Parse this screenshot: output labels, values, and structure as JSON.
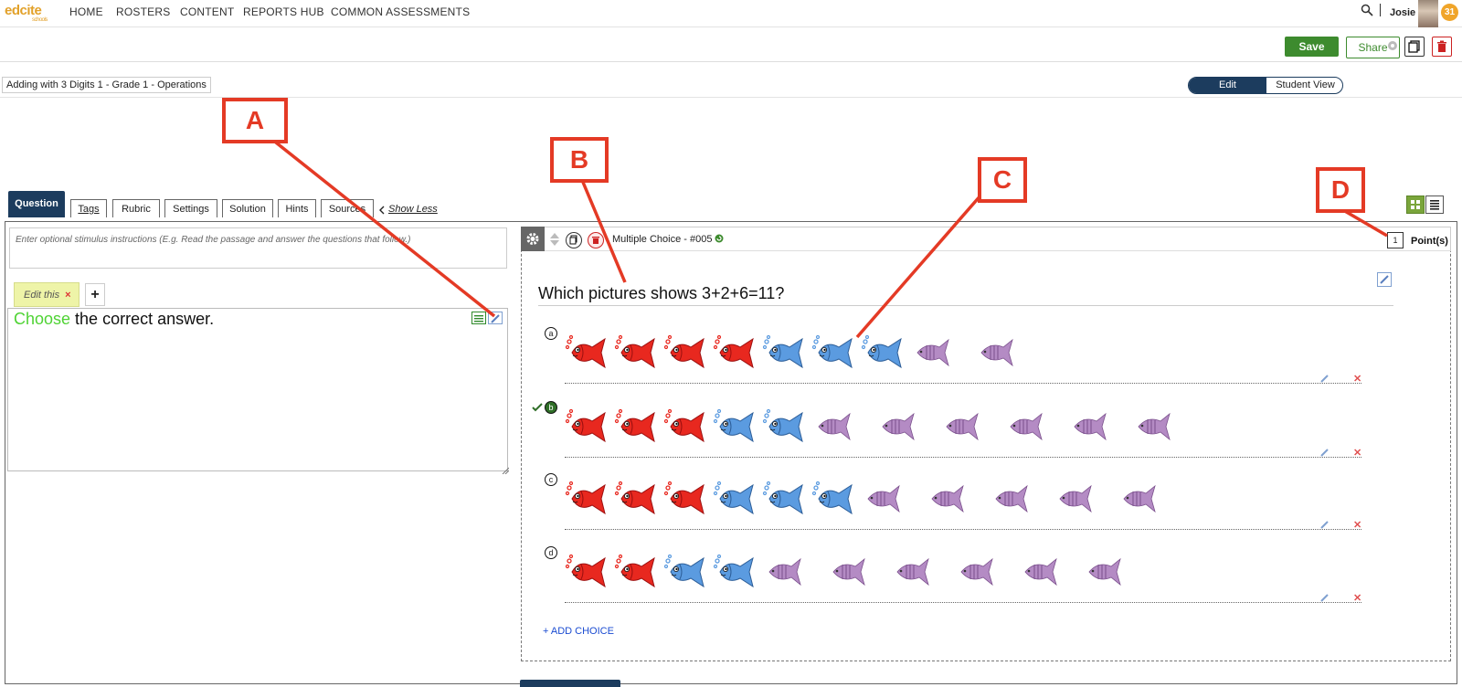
{
  "nav": {
    "logo": "edcite",
    "logo_sub": "schools",
    "links": [
      "HOME",
      "ROSTERS",
      "CONTENT",
      "REPORTS HUB",
      "COMMON ASSESSMENTS"
    ],
    "user": "Josie",
    "badge": "31",
    "icons": [
      "search-icon"
    ]
  },
  "toolbar": {
    "save_label": "Save",
    "share_label": "Share",
    "icons": [
      "copy-icon",
      "trash-icon"
    ]
  },
  "assessment": {
    "title": "Adding with 3 Digits 1 - Grade 1 - Operations",
    "view_edit": "Edit",
    "view_student": "Student View"
  },
  "tabs": {
    "question": "Question",
    "items": [
      "Tags",
      "Rubric",
      "Settings",
      "Solution",
      "Hints",
      "Sources"
    ],
    "show_less": "Show Less"
  },
  "stimulus": {
    "placeholder": "Enter optional stimulus instructions (E.g. Read the passage and answer the questions that follow.)"
  },
  "editor": {
    "tab_label": "Edit this",
    "tab_close": "×",
    "add_label": "+",
    "instruction_highlight": "Choose",
    "instruction_rest": " the correct answer."
  },
  "question": {
    "type_label": "Multiple Choice - #005",
    "points_value": "1",
    "points_label": "Point(s)",
    "text": "Which pictures shows 3+2+6=11?",
    "add_choice": "+ ADD CHOICE",
    "choices": [
      {
        "letter": "a",
        "correct": false,
        "fish": [
          "red",
          "red",
          "red",
          "red",
          "blue",
          "blue",
          "blue",
          "purple",
          "purple"
        ]
      },
      {
        "letter": "b",
        "correct": true,
        "fish": [
          "red",
          "red",
          "red",
          "blue",
          "blue",
          "purple",
          "purple",
          "purple",
          "purple",
          "purple",
          "purple"
        ]
      },
      {
        "letter": "c",
        "correct": false,
        "fish": [
          "red",
          "red",
          "red",
          "blue",
          "blue",
          "blue",
          "purple",
          "purple",
          "purple",
          "purple",
          "purple"
        ]
      },
      {
        "letter": "d",
        "correct": false,
        "fish": [
          "red",
          "red",
          "blue",
          "blue",
          "purple",
          "purple",
          "purple",
          "purple",
          "purple",
          "purple"
        ]
      }
    ]
  },
  "callouts": [
    "A",
    "B",
    "C",
    "D"
  ],
  "colors": {
    "navy": "#1c3c5e",
    "save_green": "#3d8b2e",
    "callout_red": "#e43a25",
    "fish_red": "#e8281f",
    "fish_blue": "#5b9be0",
    "fish_purple": "#b48bc4"
  }
}
